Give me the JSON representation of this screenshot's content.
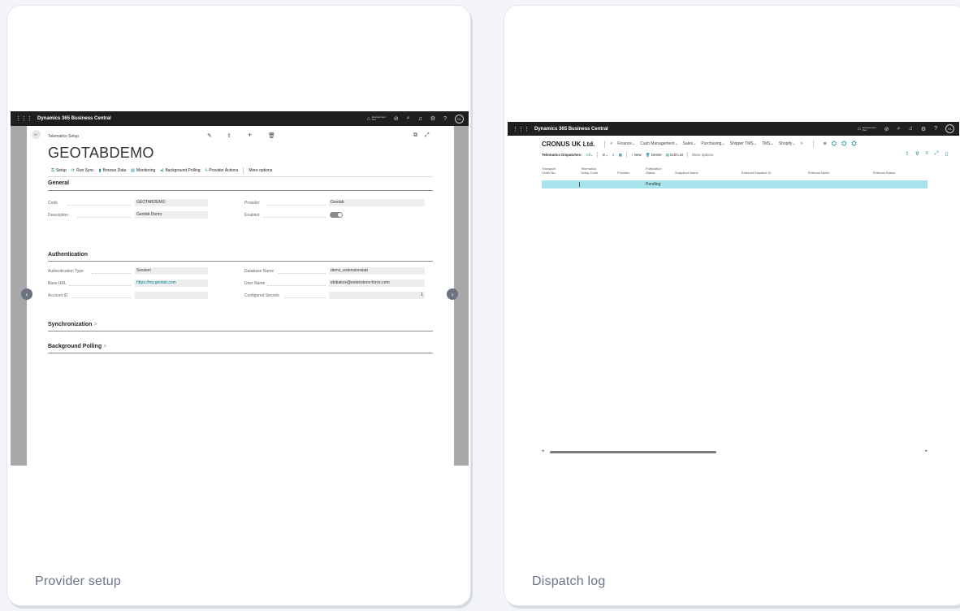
{
  "panels": [
    {
      "caption": "Provider setup"
    },
    {
      "caption": "Dispatch log"
    }
  ],
  "left_app": {
    "app_name": "Dynamics 365 Business Central",
    "env_label": "Environment",
    "env_name": "Dev",
    "avatar": "OL",
    "breadcrumb": "Telematics Setup",
    "title": "GEOTABDEMO",
    "actions": [
      "Setup",
      "Run Sync",
      "Browse Data",
      "Monitoring",
      "Background Polling",
      "Provider Actions",
      "More options"
    ],
    "general": {
      "title": "General",
      "code_label": "Code",
      "code_value": "GEOTABDEMO",
      "provider_label": "Provider",
      "provider_value": "Geotab",
      "description_label": "Description",
      "description_value": "Geotab Demo",
      "enabled_label": "Enabled"
    },
    "auth": {
      "title": "Authentication",
      "auth_type_label": "Authentication Type",
      "auth_type_value": "Session",
      "db_label": "Database Name",
      "db_value": "demo_extensionslab",
      "base_url_label": "Base URL",
      "base_url_value": "https://my.geotab.com",
      "user_label": "User Name",
      "user_value": "idobakov@extensions-force.com",
      "account_label": "Account ID",
      "secrets_label": "Configured Secrets",
      "secrets_value": "1"
    },
    "sync_title": "Synchronization",
    "polling_title": "Background Polling"
  },
  "right_app": {
    "app_name": "Dynamics 365 Business Central",
    "env_label": "Environment",
    "env_name": "Dev",
    "avatar": "OL",
    "company": "CRONUS UK Ltd.",
    "menu": [
      "Finance",
      "Cash Management",
      "Sales",
      "Purchasing",
      "Shipper TMS",
      "TMS",
      "Shopify"
    ],
    "list_title": "Telematics Dispatches:",
    "filter": "All",
    "new_label": "New",
    "delete_label": "Delete",
    "edit_label": "Edit List",
    "more_label": "More options",
    "columns": [
      "Transport Order No.",
      "Telematics Setup Code",
      "Provider",
      "Publication Status",
      "Snapshot Name",
      "External Dispatch ID",
      "External Name",
      "External Status"
    ],
    "row": {
      "status": "Pending"
    }
  },
  "colors": {
    "accent": "#008489",
    "selected_row": "#a6e3ea",
    "toggle": "#8a8a8a"
  }
}
